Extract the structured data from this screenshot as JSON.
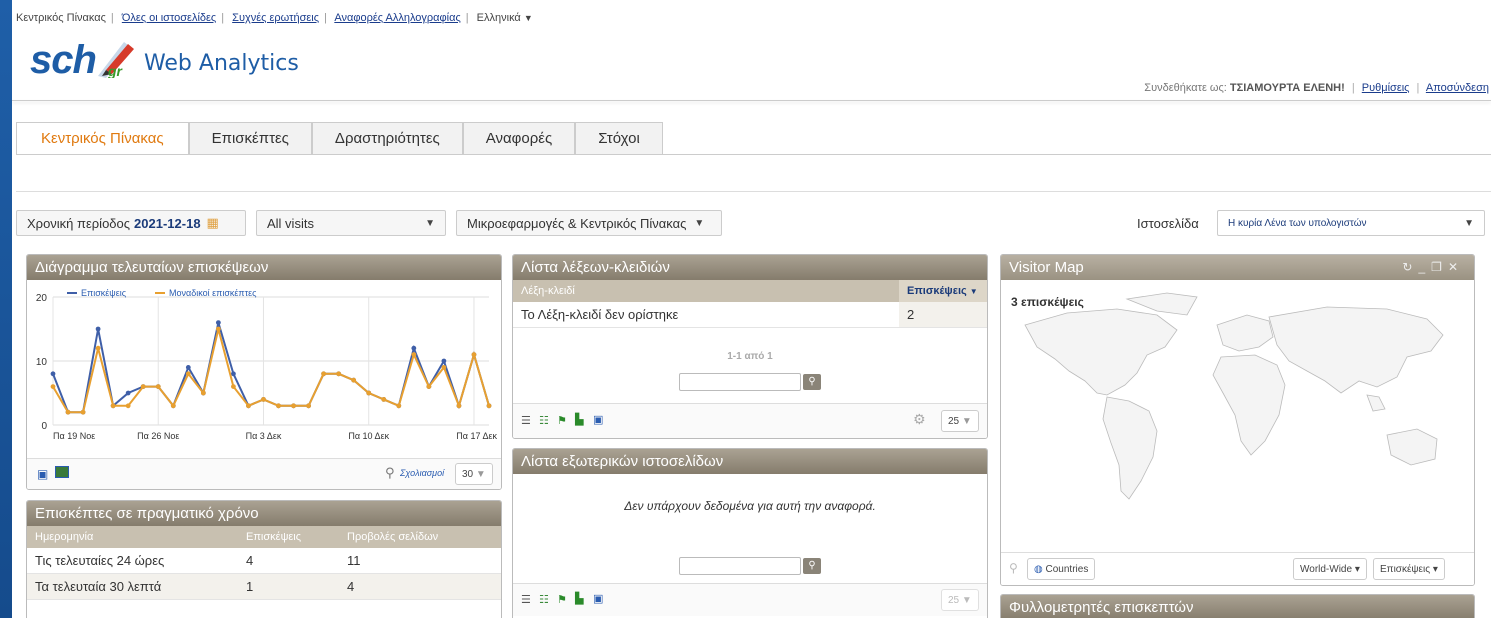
{
  "top_links": {
    "dashboard": "Κεντρικός Πίνακας",
    "all_sites": "Όλες οι ιστοσελίδες",
    "faq": "Συχνές ερωτήσεις",
    "email_reports": "Αναφορές Αλληλογραφίας",
    "language": "Ελληνικά"
  },
  "logo": {
    "brand": "sch.gr",
    "product": "Web Analytics"
  },
  "user": {
    "prefix": "Συνδεθήκατε ως:",
    "name": "ΤΣΙΑΜΟΥΡΤΑ ΕΛΕΝΗ!",
    "settings": "Ρυθμίσεις",
    "logout": "Αποσύνδεση"
  },
  "tabs": [
    "Κεντρικός Πίνακας",
    "Επισκέπτες",
    "Δραστηριότητες",
    "Αναφορές",
    "Στόχοι"
  ],
  "controls": {
    "period_label": "Χρονική περίοδος",
    "period_value": "2021-12-18",
    "segment": "All visits",
    "widgets_menu": "Μικροεφαρμογές & Κεντρικός Πίνακας",
    "site_label": "Ιστοσελίδα",
    "site_value": "Η κυρία Λένα των υπολογιστών"
  },
  "colors": {
    "visits": "#3f5fa8",
    "unique": "#e8a030",
    "accent": "#e07a10",
    "widget_title": "#8f8676"
  },
  "visits_overview": {
    "title": "Διάγραμμα τελευταίων επισκέψεων",
    "footer_annotations": "Σχολιασμοί",
    "footer_limit": "30"
  },
  "chart_data": {
    "type": "line",
    "x": [
      "19 Νοε",
      "20 Νοε",
      "21 Νοε",
      "22 Νοε",
      "23 Νοε",
      "24 Νοε",
      "25 Νοε",
      "26 Νοε",
      "27 Νοε",
      "28 Νοε",
      "29 Νοε",
      "30 Νοε",
      "1 Δεκ",
      "2 Δεκ",
      "3 Δεκ",
      "4 Δεκ",
      "5 Δεκ",
      "6 Δεκ",
      "7 Δεκ",
      "8 Δεκ",
      "9 Δεκ",
      "10 Δεκ",
      "11 Δεκ",
      "12 Δεκ",
      "13 Δεκ",
      "14 Δεκ",
      "15 Δεκ",
      "16 Δεκ",
      "17 Δεκ",
      "18 Δεκ"
    ],
    "tick_labels": [
      "Πα 19 Νοε",
      "Πα 26 Νοε",
      "Πα 3 Δεκ",
      "Πα 10 Δεκ",
      "Πα 17 Δεκ"
    ],
    "series": [
      {
        "name": "Επισκέψεις",
        "values": [
          8,
          2,
          2,
          15,
          3,
          5,
          6,
          6,
          3,
          9,
          5,
          16,
          8,
          3,
          4,
          3,
          3,
          3,
          8,
          8,
          7,
          5,
          4,
          3,
          12,
          6,
          10,
          3,
          11,
          3
        ]
      },
      {
        "name": "Μοναδικοί επισκέπτες",
        "values": [
          6,
          2,
          2,
          12,
          3,
          3,
          6,
          6,
          3,
          8,
          5,
          15,
          6,
          3,
          4,
          3,
          3,
          3,
          8,
          8,
          7,
          5,
          4,
          3,
          11,
          6,
          9,
          3,
          11,
          3
        ]
      }
    ],
    "ylim": [
      0,
      20
    ],
    "yticks": [
      0,
      10,
      20
    ],
    "grid": true,
    "legend": "top-left"
  },
  "realtime": {
    "title": "Επισκέπτες σε πραγματικό χρόνο",
    "columns": [
      "Ημερομηνία",
      "Επισκέψεις",
      "Προβολές σελίδων"
    ],
    "rows": [
      [
        "Τις τελευταίες 24 ώρες",
        "4",
        "11"
      ],
      [
        "Τα τελευταία 30 λεπτά",
        "1",
        "4"
      ]
    ]
  },
  "keywords": {
    "title": "Λίστα λέξεων-κλειδιών",
    "columns": [
      "Λέξη-κλειδί",
      "Επισκέψεις"
    ],
    "rows": [
      [
        "Το Λέξη-κλειδί δεν ορίστηκε",
        "2"
      ]
    ],
    "pagination": "1-1 από 1",
    "limit": "25"
  },
  "websites": {
    "title": "Λίστα εξωτερικών ιστοσελίδων",
    "empty": "Δεν υπάρχουν δεδομένα για αυτή την αναφορά.",
    "limit": "25"
  },
  "map": {
    "title": "Visitor Map",
    "count": "3 επισκέψεις",
    "level": "Countries",
    "region": "World-Wide",
    "metric": "Επισκέψεις"
  },
  "browsers": {
    "title": "Φυλλομετρητές επισκεπτών"
  }
}
